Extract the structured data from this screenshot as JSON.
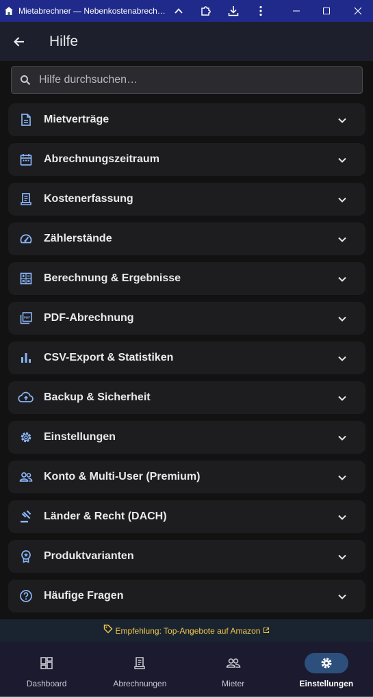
{
  "window": {
    "title": "Mietabrechner — Nebenkostenabrechnung",
    "buttons": [
      "chevron-up-icon",
      "extension-icon",
      "download-icon",
      "more-vert-icon",
      "minimize-icon",
      "maximize-icon",
      "close-icon"
    ]
  },
  "appbar": {
    "title": "Hilfe"
  },
  "search": {
    "placeholder": "Hilfe durchsuchen…"
  },
  "sections": [
    {
      "label": "Mietverträge",
      "icon": "document-icon"
    },
    {
      "label": "Abrechnungszeitraum",
      "icon": "calendar-icon"
    },
    {
      "label": "Kostenerfassung",
      "icon": "receipt-icon"
    },
    {
      "label": "Zählerstände",
      "icon": "gauge-icon"
    },
    {
      "label": "Berechnung & Ergebnisse",
      "icon": "calculator-icon"
    },
    {
      "label": "PDF-Abrechnung",
      "icon": "pdf-icon"
    },
    {
      "label": "CSV-Export & Statistiken",
      "icon": "bar-chart-icon"
    },
    {
      "label": "Backup & Sicherheit",
      "icon": "cloud-upload-icon"
    },
    {
      "label": "Einstellungen",
      "icon": "gear-icon"
    },
    {
      "label": "Konto & Multi-User (Premium)",
      "icon": "people-icon"
    },
    {
      "label": "Länder & Recht (DACH)",
      "icon": "gavel-icon"
    },
    {
      "label": "Produktvarianten",
      "icon": "badge-icon"
    },
    {
      "label": "Häufige Fragen",
      "icon": "help-icon"
    }
  ],
  "promo": {
    "text": "Empfehlung: Top-Angebote auf Amazon"
  },
  "bottom_nav": [
    {
      "label": "Dashboard",
      "icon": "dashboard-icon",
      "active": false
    },
    {
      "label": "Abrechnungen",
      "icon": "receipt-icon",
      "active": false
    },
    {
      "label": "Mieter",
      "icon": "people-icon",
      "active": false
    },
    {
      "label": "Einstellungen",
      "icon": "gear-icon",
      "active": true
    }
  ],
  "colors": {
    "accent": "#8ab4f8",
    "titlebar": "#1f2a8a",
    "promo_text": "#f2c94c",
    "active_pill": "#2d4f7c"
  }
}
